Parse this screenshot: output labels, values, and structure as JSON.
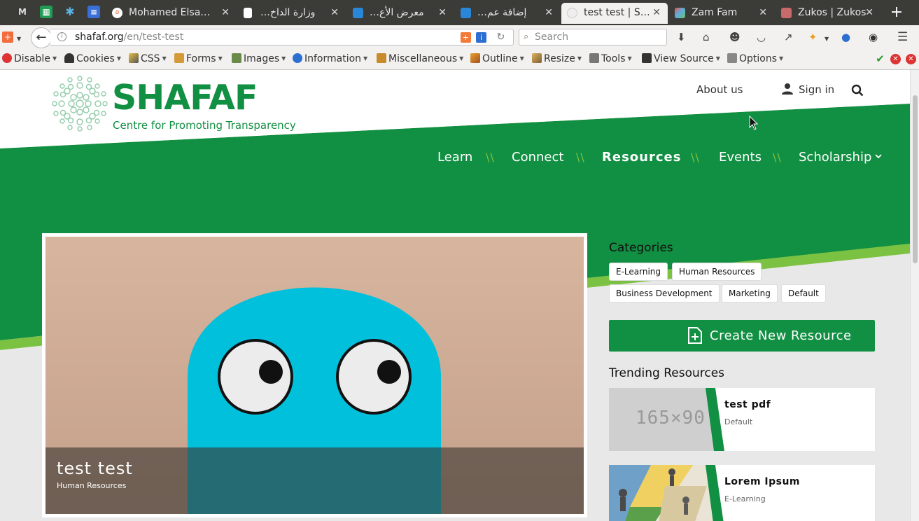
{
  "browser": {
    "tabs": [
      {
        "title": "Mohamed Elsa…",
        "fav_color": "#e2562c",
        "fav_text": "o"
      },
      {
        "title": "…وزارة الداخ",
        "fav_color": "#ffffff",
        "fav_text": ""
      },
      {
        "title": "…معرض الأع",
        "fav_color": "#2a86d9",
        "fav_text": ""
      },
      {
        "title": "…إضافة عم",
        "fav_color": "#2a86d9",
        "fav_text": ""
      },
      {
        "title": "test test | S…",
        "fav_color": "#dddddd",
        "fav_text": ""
      },
      {
        "title": "Zam Fam",
        "fav_color": "#b05ab0",
        "fav_text": ""
      },
      {
        "title": "Zukos | Zukos",
        "fav_color": "#c86a6a",
        "fav_text": ""
      }
    ],
    "pinned": [
      "M",
      "▦",
      "✱",
      "≡"
    ],
    "new_tab": "+",
    "url_host": "shafaf.org",
    "url_path": "/en/test-test",
    "search_placeholder": "Search"
  },
  "devtoolbar": {
    "items": [
      "Disable",
      "Cookies",
      "CSS",
      "Forms",
      "Images",
      "Information",
      "Miscellaneous",
      "Outline",
      "Resize",
      "Tools",
      "View Source",
      "Options"
    ]
  },
  "site": {
    "logo_word": "SHAFAF",
    "logo_tagline": "Centre for Promoting Transparency",
    "about": "About us",
    "signin": "Sign in",
    "nav": [
      "Learn",
      "Connect",
      "Resources",
      "Events",
      "Scholarship"
    ],
    "nav_sep": "\\\\",
    "featured_title": "test test",
    "featured_category": "Human Resources",
    "categories_heading": "Categories",
    "categories": [
      "E-Learning",
      "Human Resources",
      "Business Development",
      "Marketing",
      "Default"
    ],
    "create_button": "Create New Resource",
    "trending_heading": "Trending Resources",
    "trending": [
      {
        "title": "test pdf",
        "category": "Default",
        "thumb_text": "165×90"
      },
      {
        "title": "Lorem Ipsum",
        "category": "E-Learning"
      }
    ]
  },
  "colors": {
    "brand_green": "#118f42",
    "lime": "#7cc242",
    "tab_bar": "#3b3b38"
  }
}
